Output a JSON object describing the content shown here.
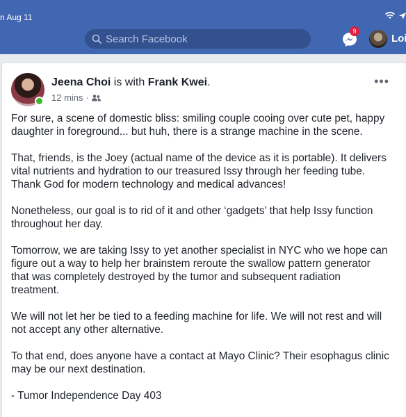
{
  "status_bar": {
    "date": "n Aug 11"
  },
  "topbar": {
    "search_placeholder": "Search Facebook",
    "messenger_badge": "9",
    "profile_name": "Loi"
  },
  "post": {
    "author": "Jeena Choi",
    "with_text": " is with ",
    "tagged": "Frank Kwei",
    "period": ".",
    "time": "12 mins",
    "separator": "·",
    "more": "•••",
    "paragraphs": [
      "For sure, a scene of domestic bliss: smiling couple cooing over cute pet, happy daughter in foreground... but huh, there is a strange machine in the scene.",
      "That, friends, is the Joey (actual name of the device as it is portable). It delivers vital nutrients and hydration to our treasured Issy through her feeding tube. Thank God for modern technology and medical advances!",
      "Nonetheless, our goal is to rid of it and other ‘gadgets’ that help Issy function throughout her day.",
      "Tomorrow, we are taking Issy to yet another specialist in NYC who we hope can figure out a way to help her brainstem reroute the swallow pattern generator that was completely destroyed by the tumor and subsequent radiation treatment.",
      "We will not let her be tied to a feeding machine for life. We will not rest and will not accept any other alternative.",
      "To that end, does anyone have a contact at Mayo Clinic? Their esophagus clinic may be our next destination.",
      "- Tumor Independence Day 403"
    ]
  },
  "colors": {
    "brand": "#4267b2",
    "online": "#42b72a",
    "badge": "#e41e3f"
  }
}
